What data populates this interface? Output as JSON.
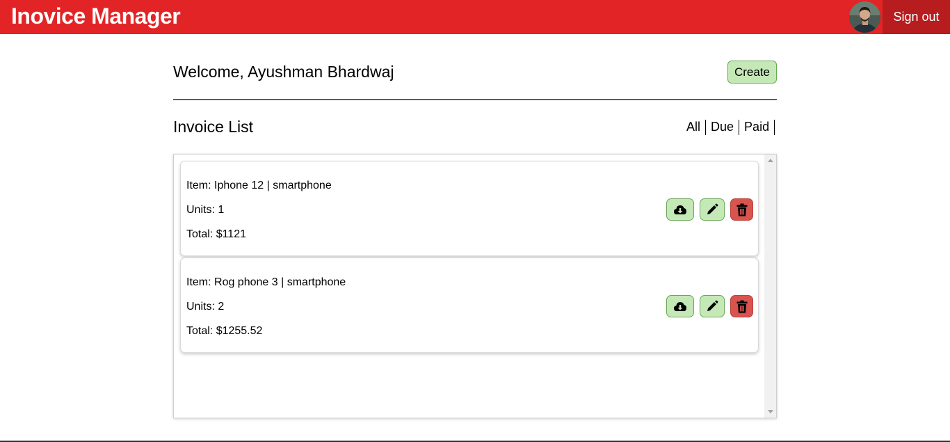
{
  "navbar": {
    "brand": "Inovice Manager",
    "signout_label": "Sign out",
    "color": "#e22426",
    "signout_color": "#b71c1f"
  },
  "header": {
    "welcome": "Welcome, Ayushman Bhardwaj",
    "create_label": "Create"
  },
  "invoice_list": {
    "title": "Invoice List",
    "filters": [
      "All",
      "Due",
      "Paid"
    ],
    "items": [
      {
        "item": "Item: Iphone 12 | smartphone",
        "units": "Units: 1",
        "total": "Total: $1121"
      },
      {
        "item": "Item: Rog phone 3 | smartphone",
        "units": "Units: 2",
        "total": "Total: $1255.52"
      }
    ]
  },
  "icons": [
    "cloud-download-icon",
    "pencil-icon",
    "trash-icon"
  ],
  "colors": {
    "action_green": "#c5e9b6",
    "action_red": "#d9534f"
  }
}
